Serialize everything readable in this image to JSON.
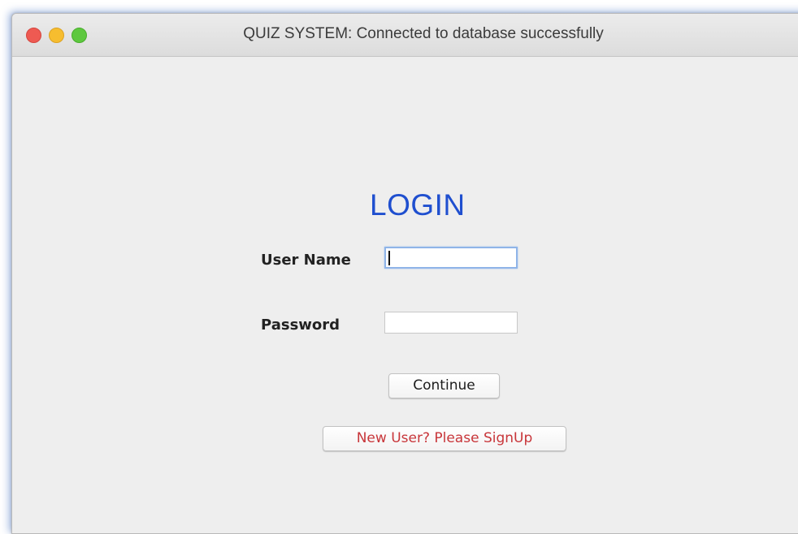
{
  "window": {
    "title": "QUIZ SYSTEM: Connected to database successfully"
  },
  "login": {
    "heading": "LOGIN",
    "username_label": "User Name",
    "username_value": "",
    "password_label": "Password",
    "password_value": "",
    "continue_label": "Continue",
    "signup_label": "New User? Please SignUp"
  },
  "colors": {
    "heading": "#1f4fcf",
    "signup_text": "#c8363a",
    "close": "#ee5a52",
    "minimize": "#f6bd2f",
    "maximize": "#5ec83f"
  },
  "icons": [
    "close-icon",
    "minimize-icon",
    "maximize-icon"
  ]
}
